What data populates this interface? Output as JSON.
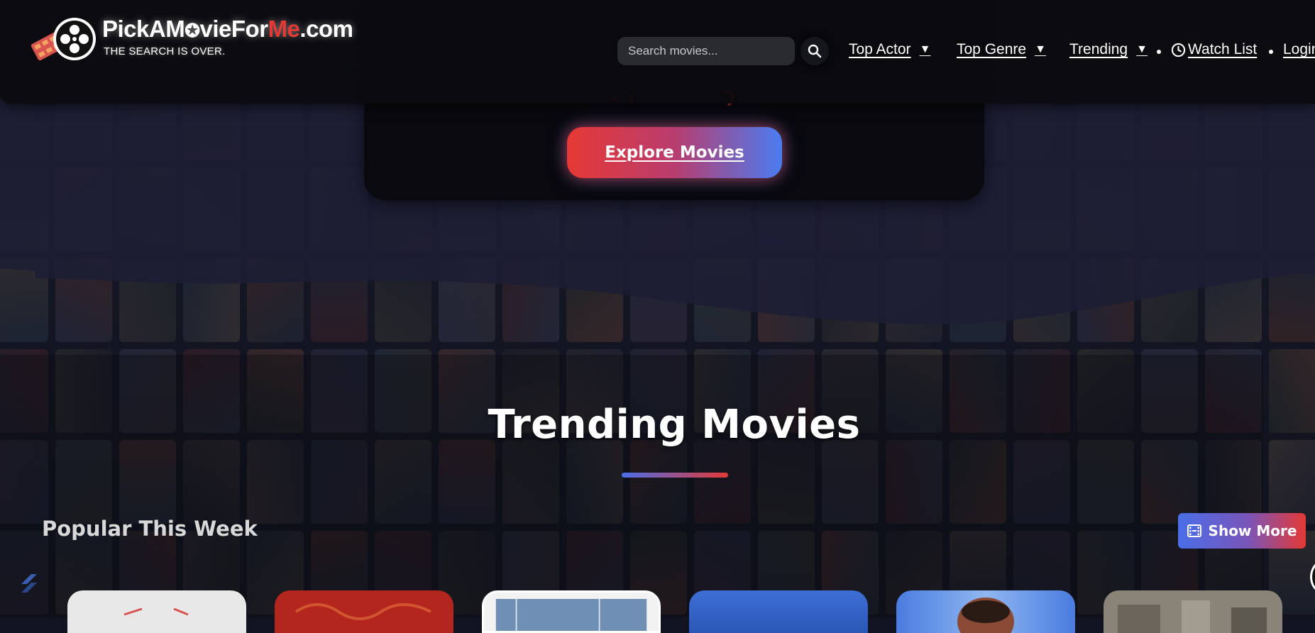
{
  "logo": {
    "name_part1": "PickAM",
    "name_star": "✪",
    "name_part2": "vieFor",
    "name_red": "Me",
    "name_suffix": ".com",
    "tagline": "THE SEARCH IS OVER."
  },
  "search": {
    "placeholder": "Search movies...",
    "button_icon": "search-icon"
  },
  "nav": {
    "items": [
      {
        "label": "Top Actor",
        "icon": "caret-down-icon",
        "caret": "▼"
      },
      {
        "label": "Top Genre",
        "icon": "caret-down-icon",
        "caret": "▼"
      },
      {
        "label": "Trending",
        "icon": "caret-down-icon",
        "caret": "▼"
      },
      {
        "label": "Watch List",
        "icon": "clock-icon"
      },
      {
        "label": "Login"
      }
    ]
  },
  "hero": {
    "cta_label": "Explore Movies"
  },
  "trending": {
    "title": "Trending Movies",
    "subheading": "Popular This Week",
    "show_more_label": "Show More",
    "show_more_icon": "film-icon"
  },
  "colors": {
    "accent_red": "#e53935",
    "accent_blue": "#4a7cf0",
    "nav_bg": "#0a0a0e",
    "page_bg": "#141622"
  }
}
